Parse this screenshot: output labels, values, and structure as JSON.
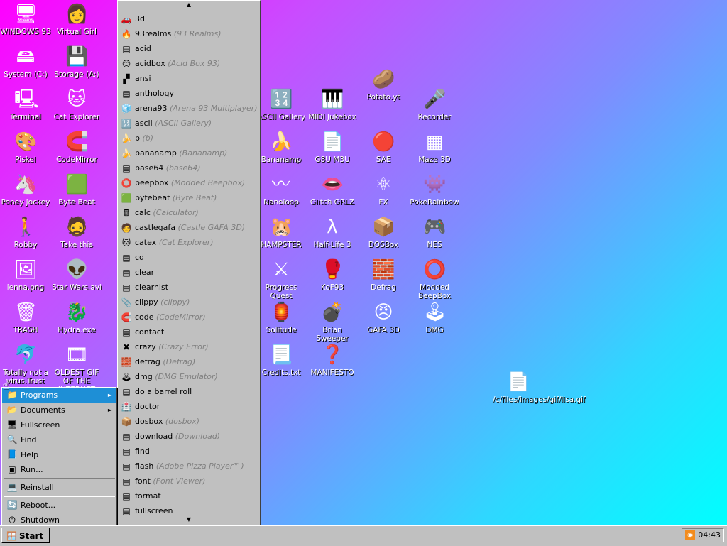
{
  "desktop": {
    "icons": [
      {
        "label": "WINDOWS 93",
        "icon": "computer-icon",
        "glyph": "🖥"
      },
      {
        "label": "Virtual Girl",
        "icon": "face-icon",
        "glyph": "👩"
      },
      {
        "label": "System (C:)",
        "icon": "drive-icon",
        "glyph": "🖴"
      },
      {
        "label": "Storage (A:)",
        "icon": "floppy-icon",
        "glyph": "💾"
      },
      {
        "label": "Terminal",
        "icon": "terminal-icon",
        "glyph": "🖳"
      },
      {
        "label": "Cat Explorer",
        "icon": "cat-globe-icon",
        "glyph": "🐱"
      },
      {
        "label": "Piskel",
        "icon": "palette-icon",
        "glyph": "🎨"
      },
      {
        "label": "CodeMirror",
        "icon": "codemirror-icon",
        "glyph": "🧲"
      },
      {
        "label": "Poney Jockey",
        "icon": "pony-icon",
        "glyph": "🦄"
      },
      {
        "label": "Byte Beat",
        "icon": "bytebeat-icon",
        "glyph": "🟩"
      },
      {
        "label": "Robby",
        "icon": "stickman-icon",
        "glyph": "🚶"
      },
      {
        "label": "Take this",
        "icon": "take-this-icon",
        "glyph": "🧔"
      },
      {
        "label": "lenna.png",
        "icon": "image-file-icon",
        "glyph": "🖼"
      },
      {
        "label": "Star Wars.avi",
        "icon": "yoda-icon",
        "glyph": "👽"
      },
      {
        "label": "TRASH",
        "icon": "trash-icon",
        "glyph": "🗑"
      },
      {
        "label": "Hydra.exe",
        "icon": "hydra-icon",
        "glyph": "🐉"
      },
      {
        "label": "Totally not a virus.Trust me...im a dolphin",
        "icon": "dolphin-icon",
        "glyph": "🐬"
      },
      {
        "label": "OLDEST GIF OF THE INTERNET",
        "icon": "gif-file-icon",
        "glyph": "🎞"
      },
      {
        "label": "ASCII Gallery",
        "icon": "ascii-gallery-icon",
        "glyph": "🔢"
      },
      {
        "label": "MIDI Jukebox",
        "icon": "piano-icon",
        "glyph": "🎹"
      },
      {
        "label": "Potato.yt",
        "icon": "potato-icon",
        "glyph": "🥔"
      },
      {
        "label": "Recorder",
        "icon": "microphone-icon",
        "glyph": "🎤"
      },
      {
        "label": "Bananamp",
        "icon": "banana-icon",
        "glyph": "🍌"
      },
      {
        "label": "G8U M3U",
        "icon": "playlist-icon",
        "glyph": "📄"
      },
      {
        "label": "SAE",
        "icon": "amiga-ball-icon",
        "glyph": "🔴"
      },
      {
        "label": "Maze 3D",
        "icon": "maze-icon",
        "glyph": "▦"
      },
      {
        "label": "Nanoloop",
        "icon": "nanoloop-icon",
        "glyph": "〰"
      },
      {
        "label": "Glitch GRLZ",
        "icon": "lips-icon",
        "glyph": "👄"
      },
      {
        "label": "FX",
        "icon": "atom-icon",
        "glyph": "⚛"
      },
      {
        "label": "PokeRainbow",
        "icon": "pokemon-icon",
        "glyph": "👾"
      },
      {
        "label": "HAMPSTER",
        "icon": "hamster-icon",
        "glyph": "🐹"
      },
      {
        "label": "Half-Life 3",
        "icon": "lambda-icon",
        "glyph": "λ"
      },
      {
        "label": "DOSBox",
        "icon": "dosbox-icon",
        "glyph": "📦"
      },
      {
        "label": "NES",
        "icon": "nes-icon",
        "glyph": "🎮"
      },
      {
        "label": "Progress Quest",
        "icon": "swords-icon",
        "glyph": "⚔"
      },
      {
        "label": "KoF93",
        "icon": "fighter-icon",
        "glyph": "🥊"
      },
      {
        "label": "Defrag",
        "icon": "defrag-icon",
        "glyph": "🧱"
      },
      {
        "label": "Modded BeepBox",
        "icon": "ring-icon",
        "glyph": "⭕"
      },
      {
        "label": "Solitude",
        "icon": "solitude-icon",
        "glyph": "🏮"
      },
      {
        "label": "Brian Sweeper",
        "icon": "mine-icon",
        "glyph": "💣"
      },
      {
        "label": "GAFA 3D",
        "icon": "doom-face-icon",
        "glyph": "😠"
      },
      {
        "label": "DMG",
        "icon": "gameboy-icon",
        "glyph": "🕹"
      },
      {
        "label": "Credits.txt",
        "icon": "text-file-icon",
        "glyph": "📃"
      },
      {
        "label": "MANIFESTO",
        "icon": "question-icon",
        "glyph": "❓"
      },
      {
        "label": "/c/files/images/gif/lisa.gif",
        "icon": "shortcut-file-icon",
        "glyph": "📄"
      }
    ]
  },
  "programs_menu": {
    "scroll_up": "▲",
    "scroll_down": "▼",
    "items": [
      {
        "name": "3d",
        "sub": "",
        "glyph": "🚗",
        "icon": "3d-icon"
      },
      {
        "name": "93realms",
        "sub": "(93 Realms)",
        "glyph": "🔥",
        "icon": "realms-icon"
      },
      {
        "name": "acid",
        "sub": "",
        "glyph": "▤",
        "icon": "exe-icon"
      },
      {
        "name": "acidbox",
        "sub": "(Acid Box 93)",
        "glyph": "😊",
        "icon": "smiley-icon"
      },
      {
        "name": "ansi",
        "sub": "",
        "glyph": "▞",
        "icon": "ansi-icon"
      },
      {
        "name": "anthology",
        "sub": "",
        "glyph": "▤",
        "icon": "exe-icon"
      },
      {
        "name": "arena93",
        "sub": "(Arena 93 Multiplayer)",
        "glyph": "🧊",
        "icon": "cube-icon"
      },
      {
        "name": "ascii",
        "sub": "(ASCII Gallery)",
        "glyph": "🔢",
        "icon": "ascii-icon"
      },
      {
        "name": "b",
        "sub": "(b)",
        "glyph": "🍌",
        "icon": "banana-icon"
      },
      {
        "name": "bananamp",
        "sub": "(Bananamp)",
        "glyph": "🍌",
        "icon": "banana-icon"
      },
      {
        "name": "base64",
        "sub": "(base64)",
        "glyph": "▤",
        "icon": "exe-icon"
      },
      {
        "name": "beepbox",
        "sub": "(Modded Beepbox)",
        "glyph": "⭕",
        "icon": "ring-icon"
      },
      {
        "name": "bytebeat",
        "sub": "(Byte Beat)",
        "glyph": "🟩",
        "icon": "bytebeat-icon"
      },
      {
        "name": "calc",
        "sub": "(Calculator)",
        "glyph": "🖩",
        "icon": "calculator-icon"
      },
      {
        "name": "castlegafa",
        "sub": "(Castle GAFA 3D)",
        "glyph": "🧑",
        "icon": "face-icon"
      },
      {
        "name": "catex",
        "sub": "(Cat Explorer)",
        "glyph": "🐱",
        "icon": "cat-globe-icon"
      },
      {
        "name": "cd",
        "sub": "",
        "glyph": "▤",
        "icon": "exe-icon"
      },
      {
        "name": "clear",
        "sub": "",
        "glyph": "▤",
        "icon": "exe-icon"
      },
      {
        "name": "clearhist",
        "sub": "",
        "glyph": "▤",
        "icon": "exe-icon"
      },
      {
        "name": "clippy",
        "sub": "(clippy)",
        "glyph": "📎",
        "icon": "clip-icon"
      },
      {
        "name": "code",
        "sub": "(CodeMirror)",
        "glyph": "🧲",
        "icon": "codemirror-icon"
      },
      {
        "name": "contact",
        "sub": "",
        "glyph": "▤",
        "icon": "exe-icon"
      },
      {
        "name": "crazy",
        "sub": "(Crazy Error)",
        "glyph": "✖",
        "icon": "error-icon"
      },
      {
        "name": "defrag",
        "sub": "(Defrag)",
        "glyph": "🧱",
        "icon": "defrag-icon"
      },
      {
        "name": "dmg",
        "sub": "(DMG Emulator)",
        "glyph": "🕹",
        "icon": "gameboy-icon"
      },
      {
        "name": "do a barrel roll",
        "sub": "",
        "glyph": "▤",
        "icon": "exe-icon"
      },
      {
        "name": "doctor",
        "sub": "",
        "glyph": "🏥",
        "icon": "doctor-icon"
      },
      {
        "name": "dosbox",
        "sub": "(dosbox)",
        "glyph": "📦",
        "icon": "dosbox-icon"
      },
      {
        "name": "download",
        "sub": "(Download)",
        "glyph": "▤",
        "icon": "exe-icon"
      },
      {
        "name": "find",
        "sub": "",
        "glyph": "▤",
        "icon": "exe-icon"
      },
      {
        "name": "flash",
        "sub": "(Adobe Pizza Player™)",
        "glyph": "▤",
        "icon": "exe-icon"
      },
      {
        "name": "font",
        "sub": "(Font Viewer)",
        "glyph": "▤",
        "icon": "exe-icon"
      },
      {
        "name": "format",
        "sub": "",
        "glyph": "▤",
        "icon": "exe-icon"
      },
      {
        "name": "fullscreen",
        "sub": "",
        "glyph": "▤",
        "icon": "exe-icon"
      }
    ]
  },
  "start_menu": {
    "items": [
      {
        "label": "Programs",
        "glyph": "📁",
        "icon": "programs-icon",
        "arrow": "►",
        "active": true
      },
      {
        "label": "Documents",
        "glyph": "📂",
        "icon": "documents-icon",
        "arrow": "►"
      },
      {
        "label": "Fullscreen",
        "glyph": "🖥",
        "icon": "fullscreen-icon",
        "arrow": ""
      },
      {
        "label": "Find",
        "glyph": "🔍",
        "icon": "find-icon",
        "arrow": ""
      },
      {
        "label": "Help",
        "glyph": "📘",
        "icon": "help-icon",
        "arrow": ""
      },
      {
        "label": "Run...",
        "glyph": "▣",
        "icon": "run-icon",
        "arrow": ""
      },
      {
        "sep": true
      },
      {
        "label": "Reinstall",
        "glyph": "💻",
        "icon": "reinstall-icon",
        "arrow": ""
      },
      {
        "sep": true
      },
      {
        "label": "Reboot...",
        "glyph": "🔄",
        "icon": "reboot-icon",
        "arrow": ""
      },
      {
        "label": "Shutdown",
        "glyph": "⏻",
        "icon": "shutdown-icon",
        "arrow": ""
      }
    ]
  },
  "taskbar": {
    "start_label": "Start",
    "clock": "04:43"
  }
}
